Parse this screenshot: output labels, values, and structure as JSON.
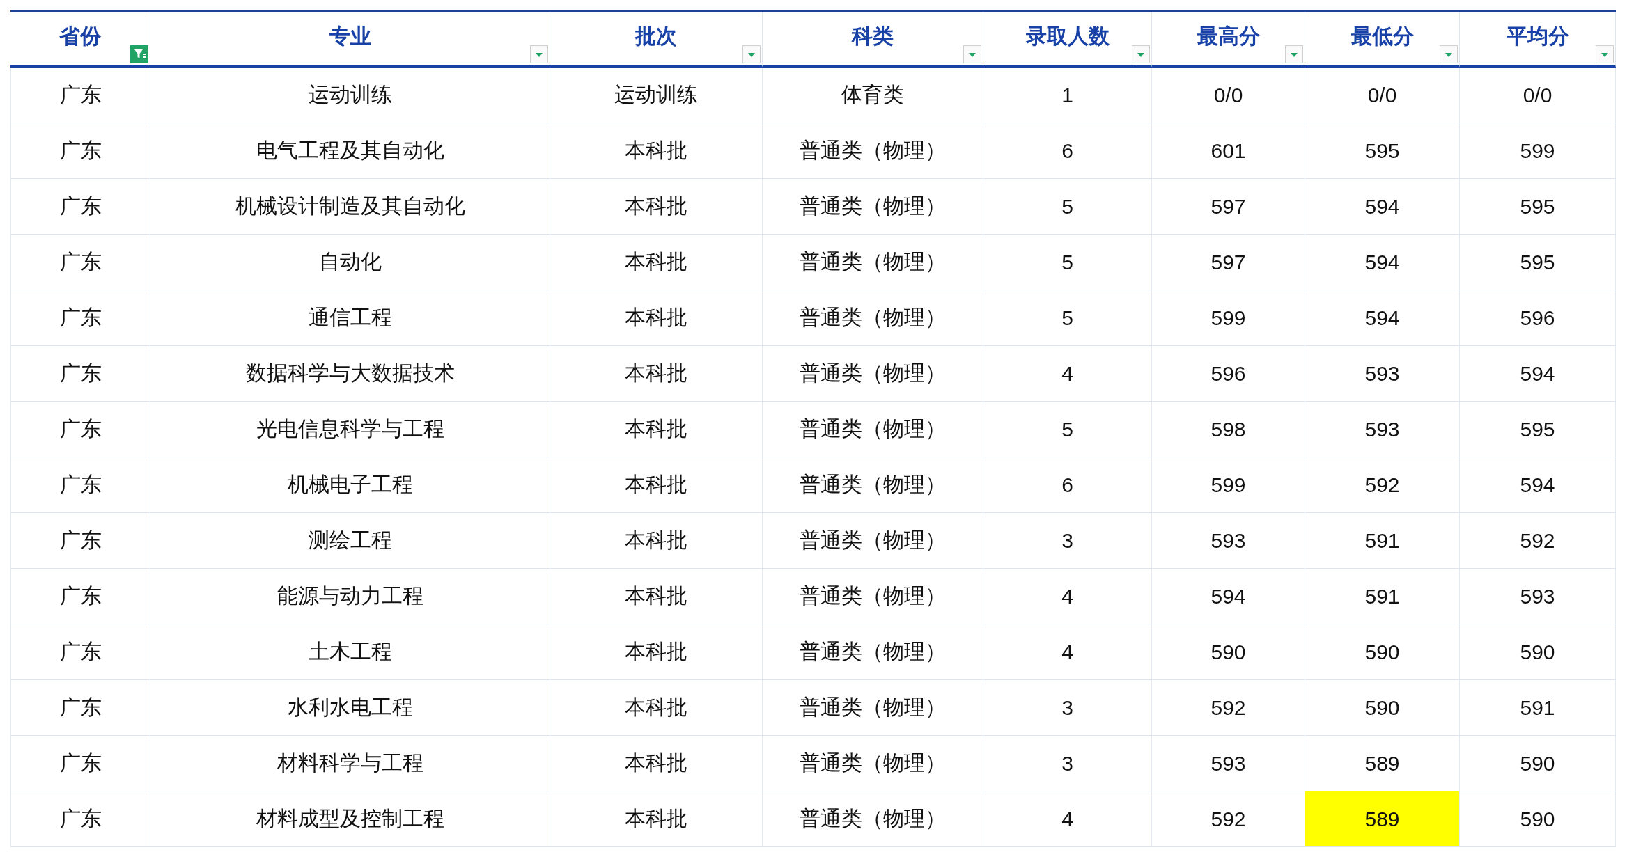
{
  "table": {
    "columns": [
      {
        "label": "省份",
        "filter_active": true
      },
      {
        "label": "专业",
        "filter_active": false
      },
      {
        "label": "批次",
        "filter_active": false
      },
      {
        "label": "科类",
        "filter_active": false
      },
      {
        "label": "录取人数",
        "filter_active": false
      },
      {
        "label": "最高分",
        "filter_active": false
      },
      {
        "label": "最低分",
        "filter_active": false
      },
      {
        "label": "平均分",
        "filter_active": false
      }
    ],
    "rows": [
      {
        "cells": [
          "广东",
          "运动训练",
          "运动训练",
          "体育类",
          "1",
          "0/0",
          "0/0",
          "0/0"
        ],
        "lowest_highlighted": false
      },
      {
        "cells": [
          "广东",
          "电气工程及其自动化",
          "本科批",
          "普通类（物理）",
          "6",
          "601",
          "595",
          "599"
        ],
        "lowest_highlighted": false
      },
      {
        "cells": [
          "广东",
          "机械设计制造及其自动化",
          "本科批",
          "普通类（物理）",
          "5",
          "597",
          "594",
          "595"
        ],
        "lowest_highlighted": false
      },
      {
        "cells": [
          "广东",
          "自动化",
          "本科批",
          "普通类（物理）",
          "5",
          "597",
          "594",
          "595"
        ],
        "lowest_highlighted": false
      },
      {
        "cells": [
          "广东",
          "通信工程",
          "本科批",
          "普通类（物理）",
          "5",
          "599",
          "594",
          "596"
        ],
        "lowest_highlighted": false
      },
      {
        "cells": [
          "广东",
          "数据科学与大数据技术",
          "本科批",
          "普通类（物理）",
          "4",
          "596",
          "593",
          "594"
        ],
        "lowest_highlighted": false
      },
      {
        "cells": [
          "广东",
          "光电信息科学与工程",
          "本科批",
          "普通类（物理）",
          "5",
          "598",
          "593",
          "595"
        ],
        "lowest_highlighted": false
      },
      {
        "cells": [
          "广东",
          "机械电子工程",
          "本科批",
          "普通类（物理）",
          "6",
          "599",
          "592",
          "594"
        ],
        "lowest_highlighted": false
      },
      {
        "cells": [
          "广东",
          "测绘工程",
          "本科批",
          "普通类（物理）",
          "3",
          "593",
          "591",
          "592"
        ],
        "lowest_highlighted": false
      },
      {
        "cells": [
          "广东",
          "能源与动力工程",
          "本科批",
          "普通类（物理）",
          "4",
          "594",
          "591",
          "593"
        ],
        "lowest_highlighted": false
      },
      {
        "cells": [
          "广东",
          "土木工程",
          "本科批",
          "普通类（物理）",
          "4",
          "590",
          "590",
          "590"
        ],
        "lowest_highlighted": false
      },
      {
        "cells": [
          "广东",
          "水利水电工程",
          "本科批",
          "普通类（物理）",
          "3",
          "592",
          "590",
          "591"
        ],
        "lowest_highlighted": false
      },
      {
        "cells": [
          "广东",
          "材料科学与工程",
          "本科批",
          "普通类（物理）",
          "3",
          "593",
          "589",
          "590"
        ],
        "lowest_highlighted": false
      },
      {
        "cells": [
          "广东",
          "材料成型及控制工程",
          "本科批",
          "普通类（物理）",
          "4",
          "592",
          "589",
          "590"
        ],
        "lowest_highlighted": true
      }
    ]
  }
}
